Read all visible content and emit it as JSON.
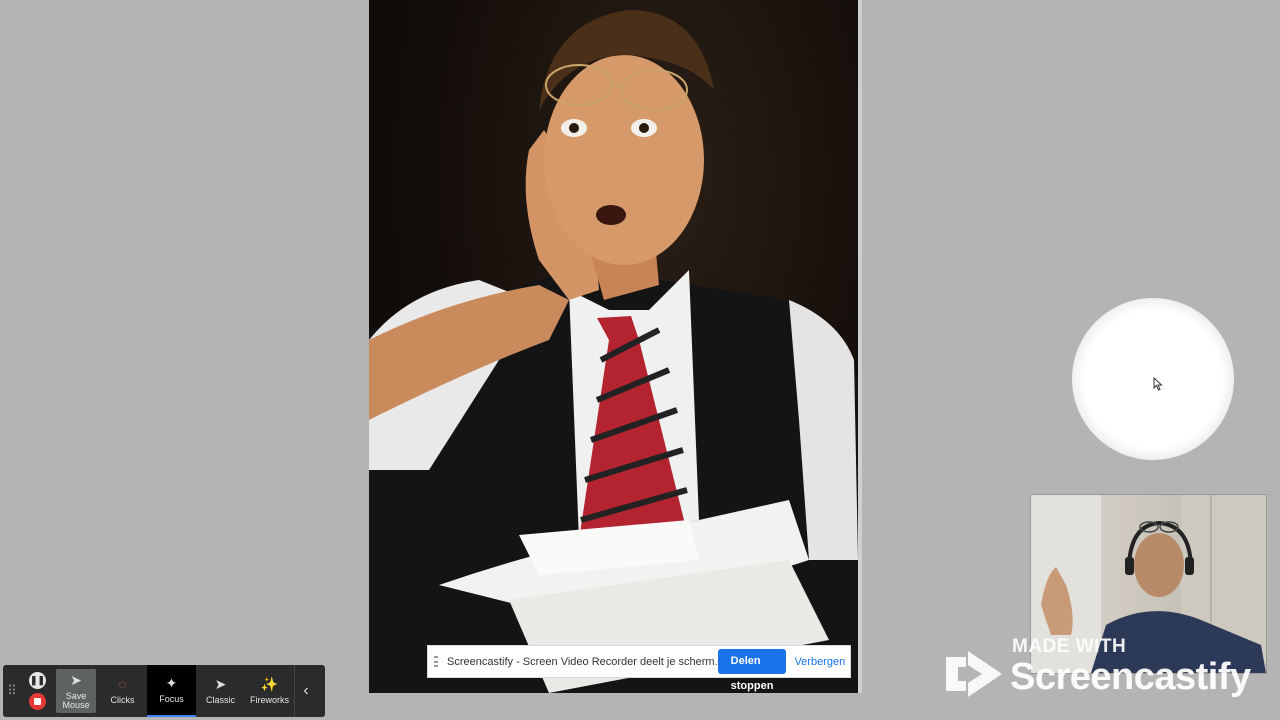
{
  "share_bar": {
    "message": "Screencastify - Screen Video Recorder deelt je scherm.",
    "stop_label": "Delen stoppen",
    "hide_label": "Verbergen"
  },
  "toolbar": {
    "pause_icon": "pause-icon",
    "stop_icon": "stop-record-icon",
    "items": [
      {
        "label": "Save\nMouse",
        "icon": "cursor-icon"
      },
      {
        "label": "Clicks",
        "icon": "click-ring-icon"
      },
      {
        "label": "Focus",
        "icon": "focus-cursor-icon"
      },
      {
        "label": "Classic",
        "icon": "classic-cursor-icon"
      },
      {
        "label": "Fireworks",
        "icon": "fireworks-icon"
      }
    ],
    "collapse_icon": "chevron-left-icon",
    "active_item": "Focus"
  },
  "watermark": {
    "made_with": "MADE WITH",
    "brand": "Screencastify"
  },
  "colors": {
    "background": "#b4b4b4",
    "accent_blue": "#1a73e8",
    "toolbar_bg": "#2b2b2b",
    "record_red": "#e53935"
  }
}
